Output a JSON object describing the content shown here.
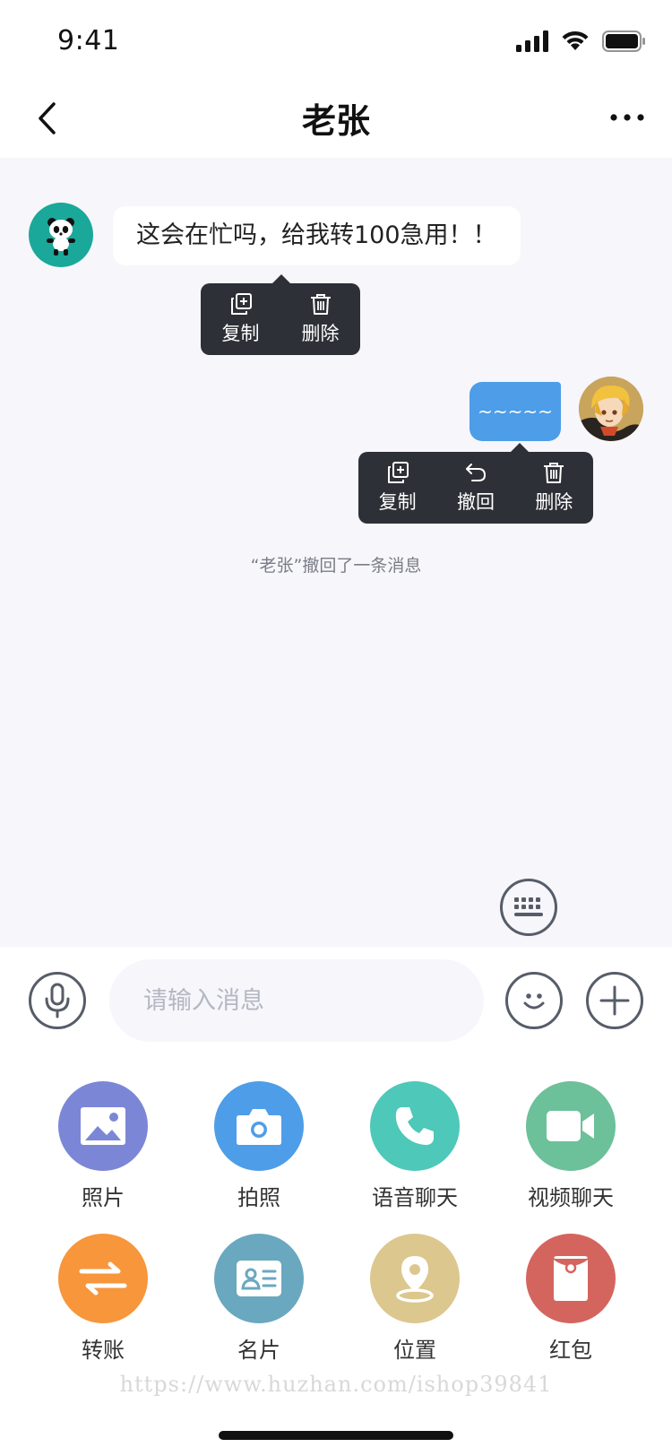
{
  "status_bar": {
    "time": "9:41"
  },
  "header": {
    "title": "老张"
  },
  "messages": {
    "incoming_text": "这会在忙吗，给我转100急用！！",
    "outgoing_text": "~~~~~"
  },
  "popup_incoming": {
    "copy_label": "复制",
    "delete_label": "删除"
  },
  "popup_outgoing": {
    "copy_label": "复制",
    "recall_label": "撤回",
    "delete_label": "删除"
  },
  "system_note": "“老张”撤回了一条消息",
  "input": {
    "placeholder": "请输入消息"
  },
  "tools": [
    {
      "label": "照片",
      "icon": "image-icon",
      "color": "#7b87d6"
    },
    {
      "label": "拍照",
      "icon": "camera-icon",
      "color": "#4e9de8"
    },
    {
      "label": "语音聊天",
      "icon": "phone-icon",
      "color": "#4ec8b8"
    },
    {
      "label": "视频聊天",
      "icon": "video-icon",
      "color": "#6cc09a"
    },
    {
      "label": "转账",
      "icon": "transfer-icon",
      "color": "#f7963a"
    },
    {
      "label": "名片",
      "icon": "contact-card-icon",
      "color": "#6aa8c0"
    },
    {
      "label": "位置",
      "icon": "location-icon",
      "color": "#dcc78e"
    },
    {
      "label": "红包",
      "icon": "red-packet-icon",
      "color": "#d4655e"
    }
  ],
  "watermark": "https://www.huzhan.com/ishop39841"
}
